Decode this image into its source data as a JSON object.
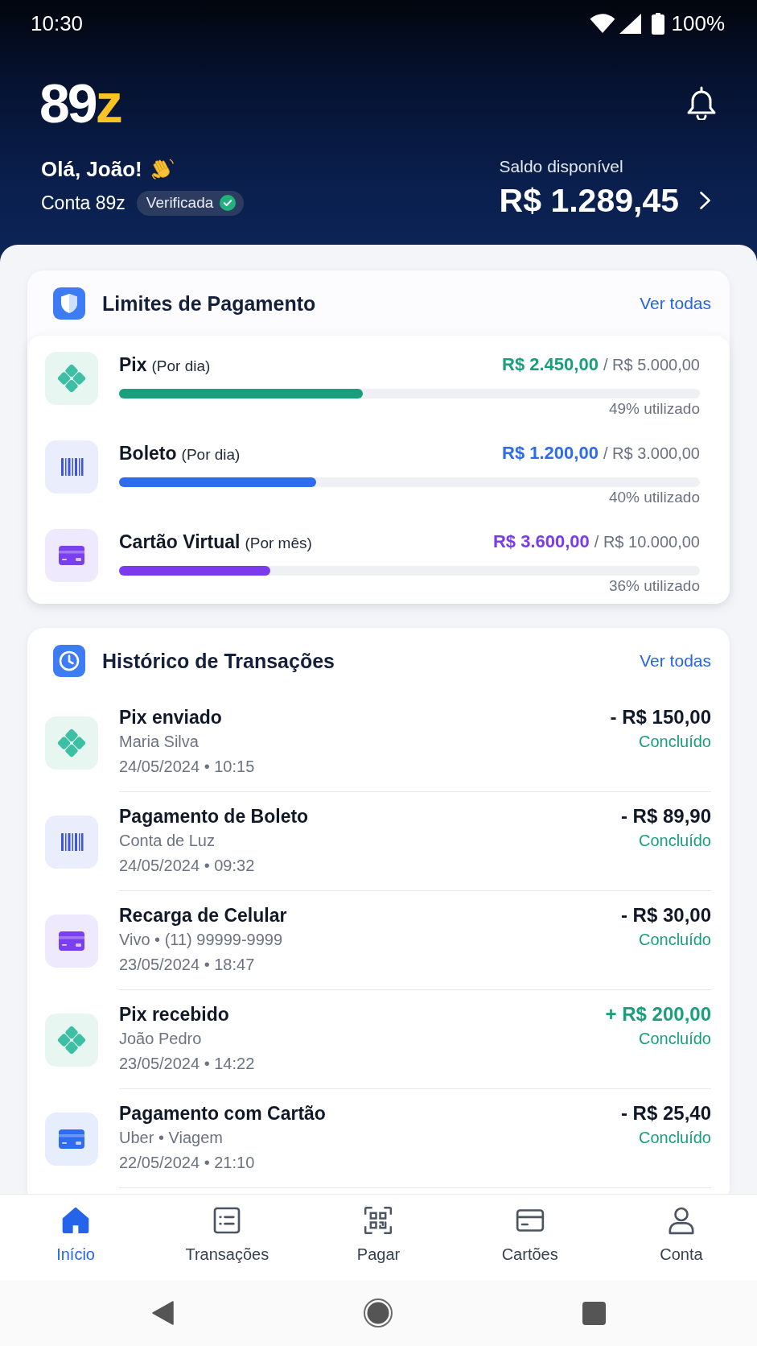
{
  "status_bar": {
    "time": "10:30",
    "battery": "100%"
  },
  "header": {
    "logo": {
      "main": "89",
      "accent": "z"
    },
    "greeting": "Olá, João!",
    "account": "Conta 89z",
    "badge": "Verificada",
    "balance_label": "Saldo disponível",
    "balance": "R$ 1.289,45"
  },
  "limits": {
    "title": "Limites de Pagamento",
    "link": "Ver todas",
    "items": [
      {
        "kind": "pix",
        "name": "Pix",
        "period": "(Por dia)",
        "used": "R$ 2.450,00",
        "limit": "/ R$ 5.000,00",
        "level": 0.42,
        "usage": "49% utilizado",
        "color": "#17a07b"
      },
      {
        "kind": "boleto",
        "name": "Boleto",
        "period": "(Por dia)",
        "used": "R$ 1.200,00",
        "limit": "/ R$ 3.000,00",
        "level": 0.34,
        "usage": "40% utilizado",
        "color": "#2f6bf0"
      },
      {
        "kind": "virtual_card",
        "name": "Cartão Virtual",
        "period": "(Por mês)",
        "used": "R$ 3.600,00",
        "limit": "/ R$ 10.000,00",
        "level": 0.26,
        "usage": "36% utilizado",
        "color": "#7c3aed"
      }
    ]
  },
  "transactions": {
    "title": "Histórico de Transações",
    "link": "Ver todas",
    "items": [
      {
        "kind": "pix",
        "title": "Pix enviado",
        "detail": "Maria Silva",
        "datetime": "24/05/2024 • 10:15",
        "amount": "- R$ 150,00",
        "incoming": false,
        "status": "Concluído"
      },
      {
        "kind": "boleto",
        "title": "Pagamento de Boleto",
        "detail": "Conta de Luz",
        "datetime": "24/05/2024 • 09:32",
        "amount": "- R$ 89,90",
        "incoming": false,
        "status": "Concluído"
      },
      {
        "kind": "virtual_card",
        "title": "Recarga de Celular",
        "detail": "Vivo • (11) 99999-9999",
        "datetime": "23/05/2024 • 18:47",
        "amount": "- R$ 30,00",
        "incoming": false,
        "status": "Concluído"
      },
      {
        "kind": "pix",
        "title": "Pix recebido",
        "detail": "João Pedro",
        "datetime": "23/05/2024 • 14:22",
        "amount": "+ R$ 200,00",
        "incoming": true,
        "status": "Concluído"
      },
      {
        "kind": "card",
        "title": "Pagamento com Cartão",
        "detail": "Uber • Viagem",
        "datetime": "22/05/2024 • 21:10",
        "amount": "- R$ 25,40",
        "incoming": false,
        "status": "Concluído"
      }
    ]
  },
  "bottom_nav": [
    {
      "kind": "home",
      "label": "Início",
      "selected": true
    },
    {
      "kind": "list",
      "label": "Transações",
      "selected": false
    },
    {
      "kind": "qr",
      "label": "Pagar",
      "selected": false
    },
    {
      "kind": "card",
      "label": "Cartões",
      "selected": false
    },
    {
      "kind": "person",
      "label": "Conta",
      "selected": false
    }
  ]
}
